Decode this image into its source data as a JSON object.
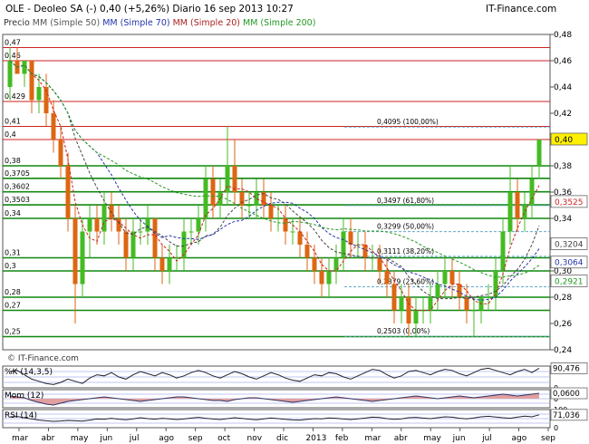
{
  "header": {
    "left": "OLE - Deoleo SA (-)    0,40 (+5,26%)    Diario  16 sep 2013 10:27",
    "right": "IT-Finance.com"
  },
  "legend": {
    "items": [
      {
        "label": "Precio",
        "color": "#333333"
      },
      {
        "label": "MM (Simple 50)",
        "color": "#555555"
      },
      {
        "label": "MM (Simple 70)",
        "color": "#2233aa"
      },
      {
        "label": "MM (Simple 20)",
        "color": "#aa2222"
      },
      {
        "label": "MM (Simple 200)",
        "color": "#229922"
      }
    ]
  },
  "watermark": "© IT-Finance.com",
  "colors": {
    "up": "#44bb22",
    "down": "#dd6611",
    "ma20": "#cc2222",
    "ma50": "#444444",
    "ma70": "#2233aa",
    "ma200": "#229922",
    "resistance": "#cc2222",
    "support": "#118811",
    "fib": "#66aacc",
    "last_price_bg": "#fff000",
    "panel_grid": "#aab0ee"
  },
  "chart_data": [
    {
      "type": "line",
      "subtype": "candlestick",
      "title": "OLE - Deoleo SA (-)",
      "ylim": [
        0.24,
        0.48
      ],
      "y_ticks": [
        "0,48",
        "0,46",
        "0,44",
        "0,42",
        "0,40",
        "0,38",
        "0,36",
        "0,34",
        "0,32",
        "0,30",
        "0,28",
        "0,26",
        "0,24"
      ],
      "x_ticks": [
        "mar",
        "abr",
        "may",
        "jun",
        "jul",
        "ago",
        "sep",
        "oct",
        "nov",
        "dic",
        "2013",
        "feb",
        "mar",
        "abr",
        "may",
        "jun",
        "jul",
        "ago",
        "sep"
      ],
      "horizontal_levels": [
        {
          "value": 0.47,
          "label": "0,47",
          "style": "resistance"
        },
        {
          "value": 0.46,
          "label": "0,46",
          "style": "resistance"
        },
        {
          "value": 0.429,
          "label": "0,429",
          "style": "resistance"
        },
        {
          "value": 0.41,
          "label": "0,41",
          "style": "resistance"
        },
        {
          "value": 0.4,
          "label": "0,4",
          "style": "resistance"
        },
        {
          "value": 0.38,
          "label": "0,38",
          "style": "support"
        },
        {
          "value": 0.3705,
          "label": "0,3705",
          "style": "support"
        },
        {
          "value": 0.3602,
          "label": "0,3602",
          "style": "support"
        },
        {
          "value": 0.3503,
          "label": "0,3503",
          "style": "support"
        },
        {
          "value": 0.34,
          "label": "0,34",
          "style": "support"
        },
        {
          "value": 0.31,
          "label": "0,31",
          "style": "support"
        },
        {
          "value": 0.3,
          "label": "0,3",
          "style": "support"
        },
        {
          "value": 0.28,
          "label": "0,28",
          "style": "support"
        },
        {
          "value": 0.27,
          "label": "0,27",
          "style": "support"
        },
        {
          "value": 0.25,
          "label": "0,25",
          "style": "support"
        }
      ],
      "fib_levels": [
        {
          "value": 0.4095,
          "label": "0,4095 (100,00%)"
        },
        {
          "value": 0.3497,
          "label": "0,3497 (61,80%)"
        },
        {
          "value": 0.3299,
          "label": "0,3299 (50,00%)"
        },
        {
          "value": 0.3111,
          "label": "0,3111 (38,20%)"
        },
        {
          "value": 0.2879,
          "label": "0,2879 (23,60%)"
        },
        {
          "value": 0.2503,
          "label": "0,2503 (0,00%)"
        }
      ],
      "right_markers": [
        {
          "value": 0.4,
          "label": "0,40",
          "style": "last"
        },
        {
          "value": 0.3525,
          "label": "0,3525",
          "style": "ma20"
        },
        {
          "value": 0.3204,
          "label": "0,3204",
          "style": "ma50"
        },
        {
          "value": 0.3064,
          "label": "0,3064",
          "style": "ma70"
        },
        {
          "value": 0.2921,
          "label": "0,2921",
          "style": "ma200"
        }
      ],
      "bars": [
        [
          0.44,
          0.47,
          0.43,
          0.46
        ],
        [
          0.46,
          0.47,
          0.45,
          0.45
        ],
        [
          0.45,
          0.46,
          0.44,
          0.46
        ],
        [
          0.46,
          0.46,
          0.42,
          0.43
        ],
        [
          0.43,
          0.45,
          0.42,
          0.44
        ],
        [
          0.44,
          0.45,
          0.41,
          0.42
        ],
        [
          0.42,
          0.43,
          0.39,
          0.4
        ],
        [
          0.4,
          0.41,
          0.37,
          0.38
        ],
        [
          0.38,
          0.39,
          0.33,
          0.34
        ],
        [
          0.34,
          0.35,
          0.26,
          0.29
        ],
        [
          0.29,
          0.34,
          0.28,
          0.33
        ],
        [
          0.33,
          0.35,
          0.31,
          0.34
        ],
        [
          0.34,
          0.35,
          0.32,
          0.33
        ],
        [
          0.33,
          0.36,
          0.32,
          0.35
        ],
        [
          0.35,
          0.36,
          0.33,
          0.34
        ],
        [
          0.34,
          0.35,
          0.32,
          0.33
        ],
        [
          0.33,
          0.34,
          0.3,
          0.31
        ],
        [
          0.31,
          0.34,
          0.3,
          0.33
        ],
        [
          0.33,
          0.34,
          0.32,
          0.33
        ],
        [
          0.33,
          0.35,
          0.32,
          0.34
        ],
        [
          0.34,
          0.34,
          0.3,
          0.31
        ],
        [
          0.31,
          0.32,
          0.29,
          0.3
        ],
        [
          0.3,
          0.32,
          0.29,
          0.31
        ],
        [
          0.31,
          0.32,
          0.3,
          0.31
        ],
        [
          0.31,
          0.34,
          0.3,
          0.33
        ],
        [
          0.33,
          0.34,
          0.32,
          0.33
        ],
        [
          0.33,
          0.35,
          0.32,
          0.34
        ],
        [
          0.34,
          0.38,
          0.33,
          0.37
        ],
        [
          0.37,
          0.38,
          0.34,
          0.35
        ],
        [
          0.35,
          0.37,
          0.34,
          0.36
        ],
        [
          0.36,
          0.41,
          0.35,
          0.38
        ],
        [
          0.38,
          0.4,
          0.35,
          0.36
        ],
        [
          0.36,
          0.37,
          0.34,
          0.35
        ],
        [
          0.35,
          0.36,
          0.34,
          0.35
        ],
        [
          0.35,
          0.37,
          0.34,
          0.36
        ],
        [
          0.36,
          0.37,
          0.34,
          0.35
        ],
        [
          0.35,
          0.36,
          0.33,
          0.34
        ],
        [
          0.34,
          0.35,
          0.33,
          0.34
        ],
        [
          0.34,
          0.35,
          0.32,
          0.33
        ],
        [
          0.33,
          0.34,
          0.32,
          0.33
        ],
        [
          0.33,
          0.34,
          0.31,
          0.32
        ],
        [
          0.32,
          0.33,
          0.3,
          0.31
        ],
        [
          0.31,
          0.32,
          0.29,
          0.3
        ],
        [
          0.3,
          0.31,
          0.28,
          0.29
        ],
        [
          0.29,
          0.31,
          0.28,
          0.3
        ],
        [
          0.3,
          0.32,
          0.29,
          0.31
        ],
        [
          0.31,
          0.34,
          0.3,
          0.33
        ],
        [
          0.33,
          0.34,
          0.31,
          0.32
        ],
        [
          0.32,
          0.33,
          0.31,
          0.32
        ],
        [
          0.32,
          0.33,
          0.3,
          0.31
        ],
        [
          0.31,
          0.32,
          0.3,
          0.31
        ],
        [
          0.31,
          0.32,
          0.29,
          0.3
        ],
        [
          0.3,
          0.31,
          0.28,
          0.29
        ],
        [
          0.29,
          0.3,
          0.26,
          0.27
        ],
        [
          0.27,
          0.29,
          0.26,
          0.28
        ],
        [
          0.28,
          0.29,
          0.25,
          0.26
        ],
        [
          0.26,
          0.28,
          0.25,
          0.27
        ],
        [
          0.27,
          0.28,
          0.26,
          0.27
        ],
        [
          0.27,
          0.29,
          0.26,
          0.28
        ],
        [
          0.28,
          0.3,
          0.27,
          0.29
        ],
        [
          0.29,
          0.31,
          0.28,
          0.3
        ],
        [
          0.3,
          0.31,
          0.28,
          0.29
        ],
        [
          0.29,
          0.3,
          0.27,
          0.28
        ],
        [
          0.28,
          0.29,
          0.26,
          0.27
        ],
        [
          0.27,
          0.28,
          0.25,
          0.27
        ],
        [
          0.27,
          0.28,
          0.26,
          0.28
        ],
        [
          0.28,
          0.29,
          0.27,
          0.28
        ],
        [
          0.28,
          0.31,
          0.27,
          0.3
        ],
        [
          0.3,
          0.34,
          0.29,
          0.33
        ],
        [
          0.33,
          0.38,
          0.32,
          0.36
        ],
        [
          0.36,
          0.37,
          0.33,
          0.34
        ],
        [
          0.34,
          0.36,
          0.33,
          0.35
        ],
        [
          0.35,
          0.38,
          0.34,
          0.37
        ],
        [
          0.38,
          0.4,
          0.37,
          0.4
        ]
      ]
    },
    {
      "type": "line",
      "title": "%K (14,3,5)",
      "value_label": "90,476",
      "ylim": [
        0,
        100
      ],
      "y_ticks": [
        "100",
        "0"
      ],
      "values": [
        75,
        80,
        60,
        40,
        30,
        20,
        15,
        25,
        40,
        30,
        20,
        45,
        60,
        55,
        70,
        50,
        40,
        60,
        75,
        65,
        55,
        70,
        60,
        45,
        55,
        70,
        80,
        70,
        55,
        45,
        60,
        75,
        65,
        50,
        40,
        55,
        70,
        60,
        45,
        35,
        30,
        45,
        60,
        55,
        70,
        65,
        50,
        40,
        55,
        70,
        85,
        80,
        60,
        45,
        55,
        75,
        80,
        70,
        60,
        75,
        85,
        80,
        65,
        55,
        70,
        85,
        90,
        80,
        70,
        60,
        75,
        85,
        70,
        90
      ]
    },
    {
      "type": "area",
      "title": "Mom (12)",
      "value_label": "0,0600",
      "ylim": [
        -0.1,
        0.1
      ],
      "y_ticks": [
        "0"
      ],
      "values": [
        0.03,
        0.02,
        0.01,
        -0.02,
        -0.04,
        -0.06,
        -0.07,
        -0.05,
        -0.03,
        -0.02,
        -0.01,
        0.0,
        0.01,
        0.02,
        0.01,
        0.0,
        -0.01,
        -0.02,
        -0.03,
        -0.02,
        -0.01,
        0.0,
        0.01,
        0.02,
        0.02,
        0.01,
        0.0,
        -0.01,
        -0.02,
        -0.02,
        -0.03,
        -0.01,
        0.0,
        0.01,
        0.01,
        0.0,
        -0.01,
        -0.02,
        -0.03,
        -0.04,
        -0.03,
        -0.02,
        -0.01,
        0.0,
        0.01,
        0.02,
        0.01,
        0.0,
        -0.01,
        -0.02,
        -0.03,
        -0.02,
        -0.01,
        0.0,
        0.01,
        0.02,
        0.03,
        0.02,
        0.01,
        0.0,
        0.01,
        0.02,
        0.03,
        0.02,
        0.01,
        0.02,
        0.03,
        0.04,
        0.05,
        0.04,
        0.03,
        0.04,
        0.05,
        0.06
      ]
    },
    {
      "type": "line",
      "title": "RSI (14)",
      "value_label": "71,036",
      "ylim": [
        0,
        100
      ],
      "y_ticks": [
        "100",
        "0"
      ],
      "values": [
        60,
        62,
        55,
        48,
        42,
        38,
        35,
        37,
        40,
        38,
        36,
        42,
        48,
        47,
        52,
        47,
        44,
        49,
        55,
        50,
        47,
        52,
        49,
        45,
        48,
        53,
        57,
        52,
        48,
        45,
        50,
        55,
        51,
        47,
        44,
        49,
        54,
        50,
        46,
        43,
        42,
        46,
        50,
        49,
        54,
        52,
        48,
        45,
        49,
        53,
        58,
        56,
        50,
        46,
        49,
        55,
        57,
        53,
        50,
        55,
        60,
        58,
        52,
        49,
        54,
        60,
        63,
        59,
        55,
        52,
        58,
        64,
        60,
        71
      ]
    }
  ]
}
